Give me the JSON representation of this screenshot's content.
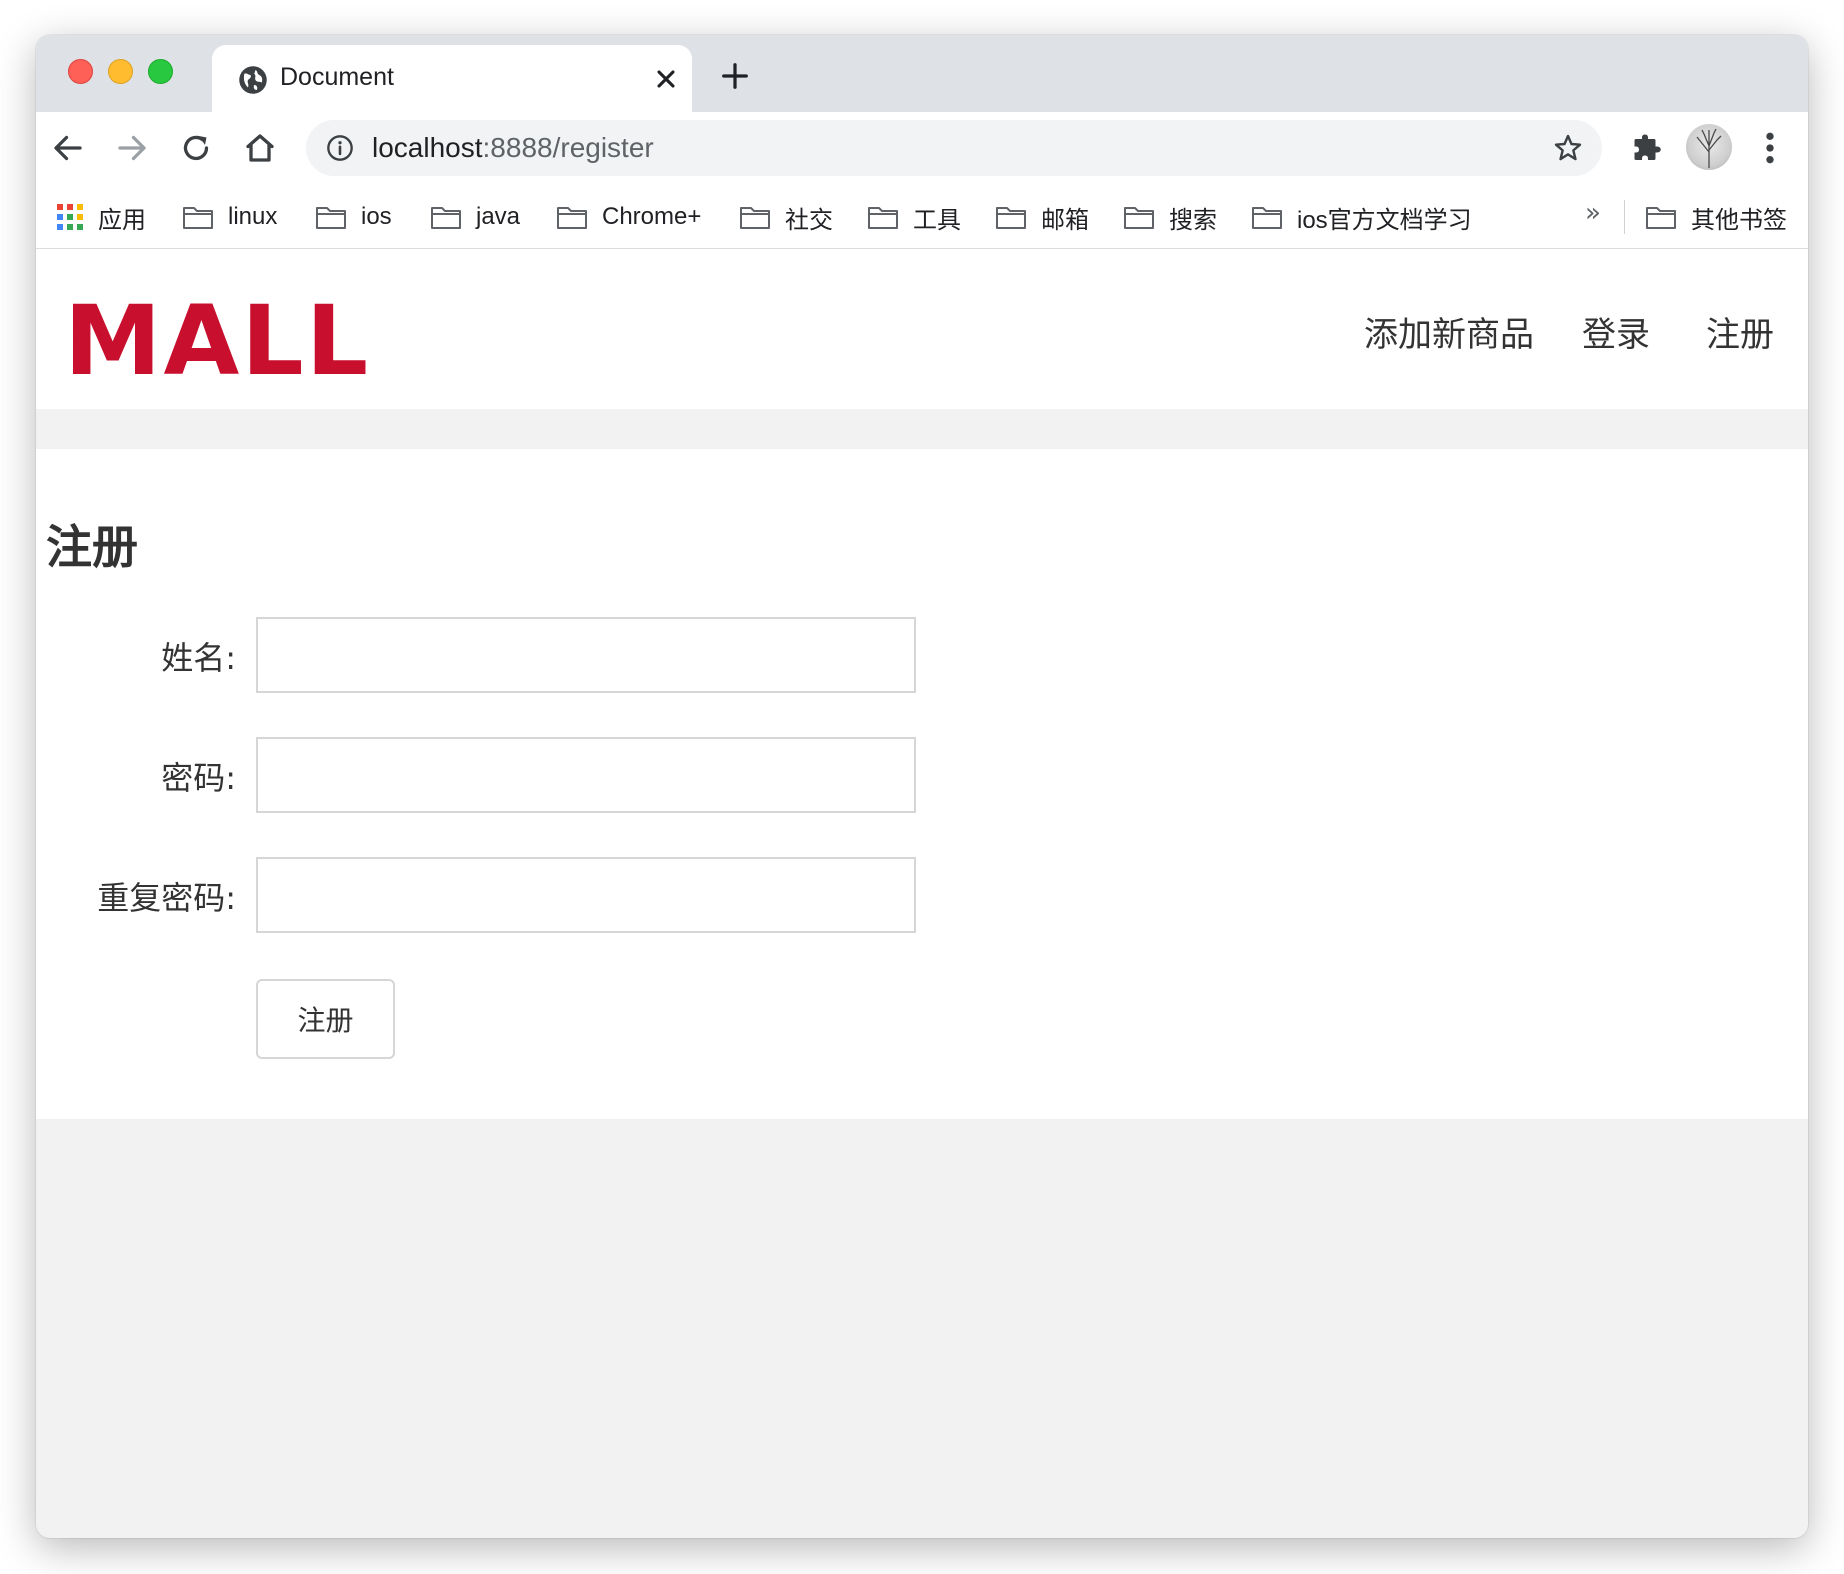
{
  "browser": {
    "tab": {
      "title": "Document"
    },
    "url": {
      "host": "localhost",
      "rest": ":8888/register"
    },
    "bookmarks": [
      {
        "label": "应用",
        "icon": "apps-grid-icon"
      },
      {
        "label": "linux",
        "icon": "folder-icon"
      },
      {
        "label": "ios",
        "icon": "folder-icon"
      },
      {
        "label": "java",
        "icon": "folder-icon"
      },
      {
        "label": "Chrome+",
        "icon": "folder-icon"
      },
      {
        "label": "社交",
        "icon": "folder-icon"
      },
      {
        "label": "工具",
        "icon": "folder-icon"
      },
      {
        "label": "邮箱",
        "icon": "folder-icon"
      },
      {
        "label": "搜索",
        "icon": "folder-icon"
      },
      {
        "label": "ios官方文档学习",
        "icon": "folder-icon"
      }
    ],
    "bookmarks_overflow": "»",
    "other_bookmarks": "其他书签"
  },
  "header": {
    "logo": "MALL",
    "nav": [
      "添加新商品",
      "登录",
      "注册"
    ],
    "logo_color": "#c8102e"
  },
  "form": {
    "title": "注册",
    "fields": [
      {
        "label": "姓名:",
        "value": ""
      },
      {
        "label": "密码:",
        "value": ""
      },
      {
        "label": "重复密码:",
        "value": ""
      }
    ],
    "submit": "注册"
  }
}
